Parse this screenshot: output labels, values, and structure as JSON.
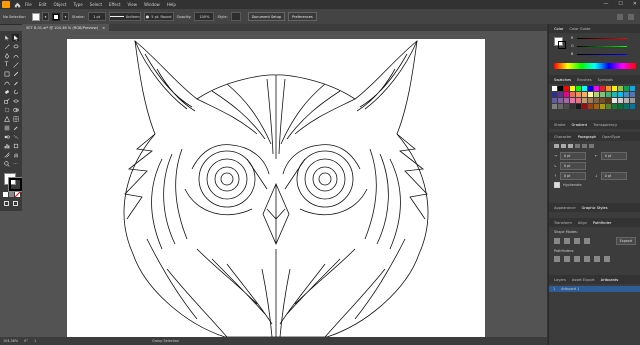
{
  "menubar": {
    "items": [
      "File",
      "Edit",
      "Object",
      "Type",
      "Select",
      "Effect",
      "View",
      "Window",
      "Help"
    ]
  },
  "control": {
    "selection_label": "No Selection",
    "stroke_label": "Stroke:",
    "stroke_value": "1 pt",
    "profile_value": "Uniform",
    "brush_value": "5 pt. Round",
    "opacity_label": "Opacity:",
    "opacity_value": "100%",
    "style_label": "Style:",
    "doc_setup": "Document Setup",
    "preferences": "Preferences"
  },
  "document": {
    "tab_title": "SET 8-01.ai* @ 104.36 % (RGB/Preview)",
    "tab_close": "×"
  },
  "status": {
    "zoom": "104.36%",
    "rotation": "0°",
    "artboard_nav": "1",
    "tool_name": "Group Selection"
  },
  "panels": {
    "color_tabs": [
      "Color",
      "Color Guide"
    ],
    "color_channel_labels": [
      "R",
      "G",
      "B"
    ],
    "swatch_tabs": [
      "Swatches",
      "Brushes",
      "Symbols"
    ],
    "stroke_tabs": [
      "Stroke",
      "Gradient",
      "Transparency"
    ],
    "char_tabs": [
      "Character",
      "Paragraph",
      "OpenType"
    ],
    "para_indent_values": [
      "0 pt",
      "0 pt",
      "0 pt",
      "0 pt",
      "0 pt"
    ],
    "hyphenate_label": "Hyphenate",
    "appearance_tabs": [
      "Appearance",
      "Graphic Styles"
    ],
    "transform_tabs": [
      "Transform",
      "Align",
      "Pathfinder"
    ],
    "shape_modes_label": "Shape Modes:",
    "expand_label": "Expand",
    "pathfinders_label": "Pathfinders:",
    "layer_tabs": [
      "Layers",
      "Asset Export",
      "Artboards"
    ],
    "artboard_row_number": "1",
    "artboard_row_name": "Artboard 1"
  },
  "colors": {
    "menubar_bg": "#323232",
    "panel_bg": "#3c3c3c",
    "canvas_bg": "#535353",
    "artboard_bg": "#ffffff",
    "accent": "#1473e6",
    "logo": "#ff9a00"
  },
  "swatch_colors": [
    "#ffffff",
    "#000000",
    "#ff0000",
    "#ffff00",
    "#00ff00",
    "#00ffff",
    "#0000ff",
    "#ff00ff",
    "#ed1c24",
    "#f7941d",
    "#fff200",
    "#8dc63f",
    "#00a651",
    "#00aeef",
    "#2e3192",
    "#662d91",
    "#ec008c",
    "#f26c4f",
    "#f68e55",
    "#fbaf5d",
    "#fff799",
    "#acd372",
    "#7cc576",
    "#3bb878",
    "#1abbb4",
    "#00bff3",
    "#438ccb",
    "#5574b9",
    "#605ca8",
    "#855fa8",
    "#a763a8",
    "#f06ea9",
    "#f26d7d",
    "#c69c6d",
    "#a67c52",
    "#8c6239",
    "#754c24",
    "#603913",
    "#e6e6e6",
    "#cccccc",
    "#b3b3b3",
    "#999999",
    "#808080",
    "#666666",
    "#4d4d4d",
    "#333333",
    "#1a1a1a",
    "#9e0b0f",
    "#a0410d",
    "#a36209",
    "#aba000",
    "#598527",
    "#1a7b30",
    "#007236",
    "#00746b",
    "#0076a3"
  ]
}
